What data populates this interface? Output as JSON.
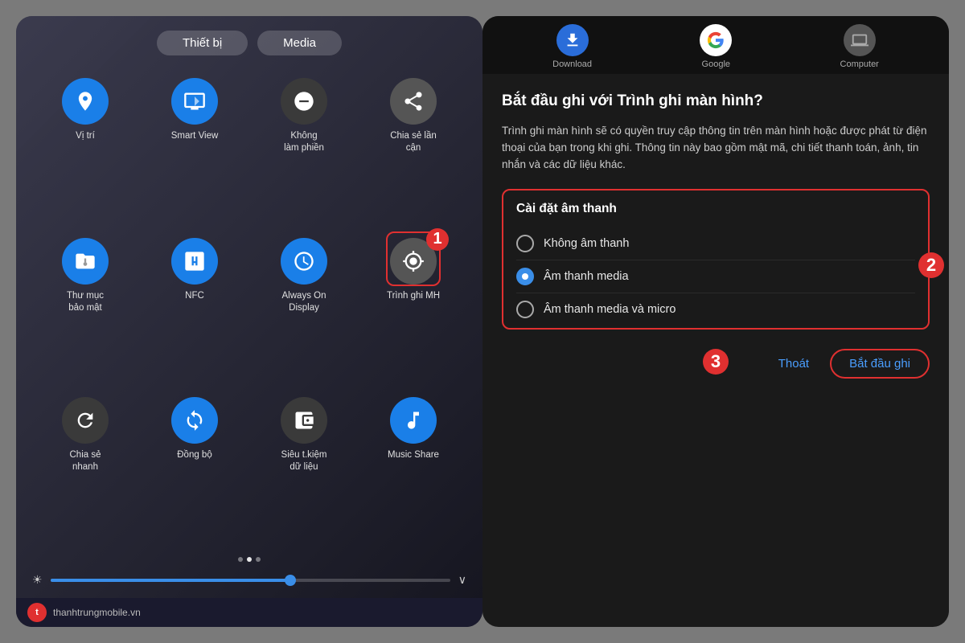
{
  "left": {
    "tabs": [
      {
        "label": "Thiết bị",
        "active": false
      },
      {
        "label": "Media",
        "active": false
      }
    ],
    "grid": [
      {
        "id": "vi-tri",
        "label": "Vị trí",
        "color": "blue",
        "icon": "📍"
      },
      {
        "id": "smart-view",
        "label": "Smart View",
        "color": "blue",
        "icon": "🔄"
      },
      {
        "id": "khong-lam-phien",
        "label": "Không\nlàm phiền",
        "color": "dark-gray",
        "icon": "🚫"
      },
      {
        "id": "chia-se-lan-can",
        "label": "Chia sẻ lần\ncận",
        "color": "dark-gray",
        "icon": "~"
      },
      {
        "id": "thu-muc-bao-mat",
        "label": "Thư mục\nbảo mật",
        "color": "blue",
        "icon": "📁"
      },
      {
        "id": "nfc",
        "label": "NFC",
        "color": "blue",
        "icon": "N"
      },
      {
        "id": "always-on-display",
        "label": "Always On\nDisplay",
        "color": "blue",
        "icon": "⏰",
        "highlight": false
      },
      {
        "id": "trinh-ghi-mh",
        "label": "Trình ghi MH",
        "color": "gray",
        "icon": "⏺",
        "highlight": true
      },
      {
        "id": "chia-se-nhanh",
        "label": "Chia sẻ\nnhanh",
        "color": "dark-gray",
        "icon": "🔄"
      },
      {
        "id": "dong-bo",
        "label": "Đồng bộ",
        "color": "blue",
        "icon": "🔁"
      },
      {
        "id": "sieu-tkiem-du-lieu",
        "label": "Siêu t.kiệm\ndữ liệu",
        "color": "dark-gray",
        "icon": "↕"
      },
      {
        "id": "music-share",
        "label": "Music Share",
        "color": "blue",
        "icon": "🎵"
      }
    ],
    "badge1": "1",
    "dots": [
      false,
      true,
      false
    ],
    "brightness_percent": 60,
    "logo_text": "thanhtrungmobile.vn"
  },
  "right": {
    "app_strip": [
      {
        "label": "Download",
        "color": "#2a6dd9"
      },
      {
        "label": "Google",
        "color": "#fff"
      },
      {
        "label": "Computer",
        "color": "#555"
      }
    ],
    "dialog_title": "Bắt đầu ghi với Trình ghi màn hình?",
    "dialog_desc": "Trình ghi màn hình sẽ có quyền truy cập thông tin trên màn hình hoặc được phát từ điện thoại của bạn trong khi ghi. Thông tin này bao gồm mật mã, chi tiết thanh toán, ảnh, tin nhắn và các dữ liệu khác.",
    "settings_title": "Cài đặt âm thanh",
    "options": [
      {
        "label": "Không âm thanh",
        "selected": false
      },
      {
        "label": "Âm thanh media",
        "selected": true
      },
      {
        "label": "Âm thanh media và micro",
        "selected": false
      }
    ],
    "badge2": "2",
    "badge3": "3",
    "btn_exit": "Thoát",
    "btn_start": "Bắt đầu ghi"
  }
}
